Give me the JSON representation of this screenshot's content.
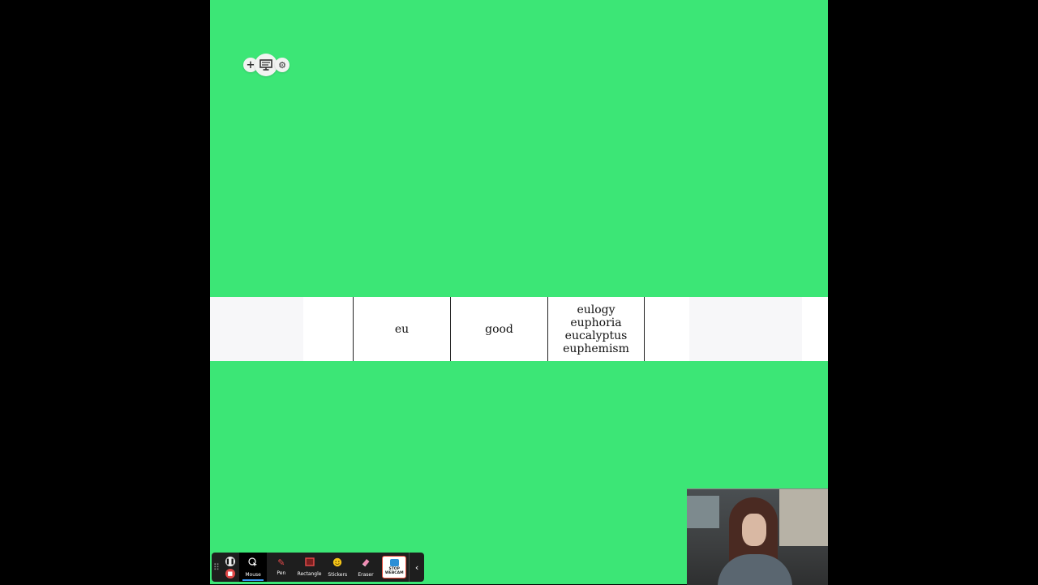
{
  "table": {
    "cells": {
      "root": "eu",
      "meaning": "good",
      "examples": [
        "eulogy",
        "euphoria",
        "eucalyptus",
        "euphemism"
      ]
    }
  },
  "toolbar": {
    "tools": [
      {
        "label": "Mouse",
        "icon": "mouse-pointer-icon",
        "active": true
      },
      {
        "label": "Pen",
        "icon": "pen-icon"
      },
      {
        "label": "Rectangle",
        "icon": "rectangle-icon"
      },
      {
        "label": "Stickers",
        "icon": "sticker-icon"
      },
      {
        "label": "Eraser",
        "icon": "eraser-icon"
      }
    ],
    "webcam_label_line1": "STOP",
    "webcam_label_line2": "WEBCAM"
  },
  "colors": {
    "slide_background": "#3ce676",
    "page_background": "#000000",
    "toolbar_background": "#1e1e1e",
    "active_indicator": "#3b9cff",
    "record_stop": "#e04848"
  }
}
